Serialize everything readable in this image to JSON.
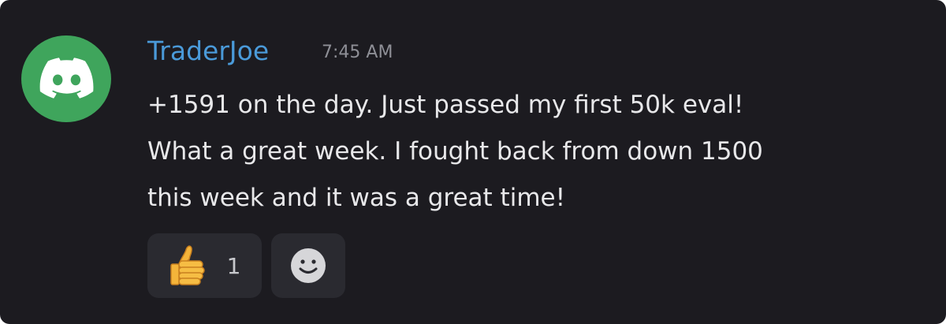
{
  "message": {
    "author": "TraderJoe",
    "timestamp": "7:45 AM",
    "lines": [
      "+1591 on the day. Just passed my first 50k eval!",
      "What a great week. I fought back from down 1500",
      "this week and it was a great time!"
    ]
  },
  "avatar": {
    "icon": "discord-logo-icon",
    "color": "#3fa55c"
  },
  "reactions": [
    {
      "icon": "thumbs-up-icon",
      "count": "1"
    },
    {
      "icon": "add-reaction-smiley-icon"
    }
  ],
  "colors": {
    "background": "#1c1b20",
    "username": "#4a9ad9",
    "timestamp": "#8e8f96",
    "text": "#e8e8ea",
    "reaction_bg": "#2a2a30"
  }
}
